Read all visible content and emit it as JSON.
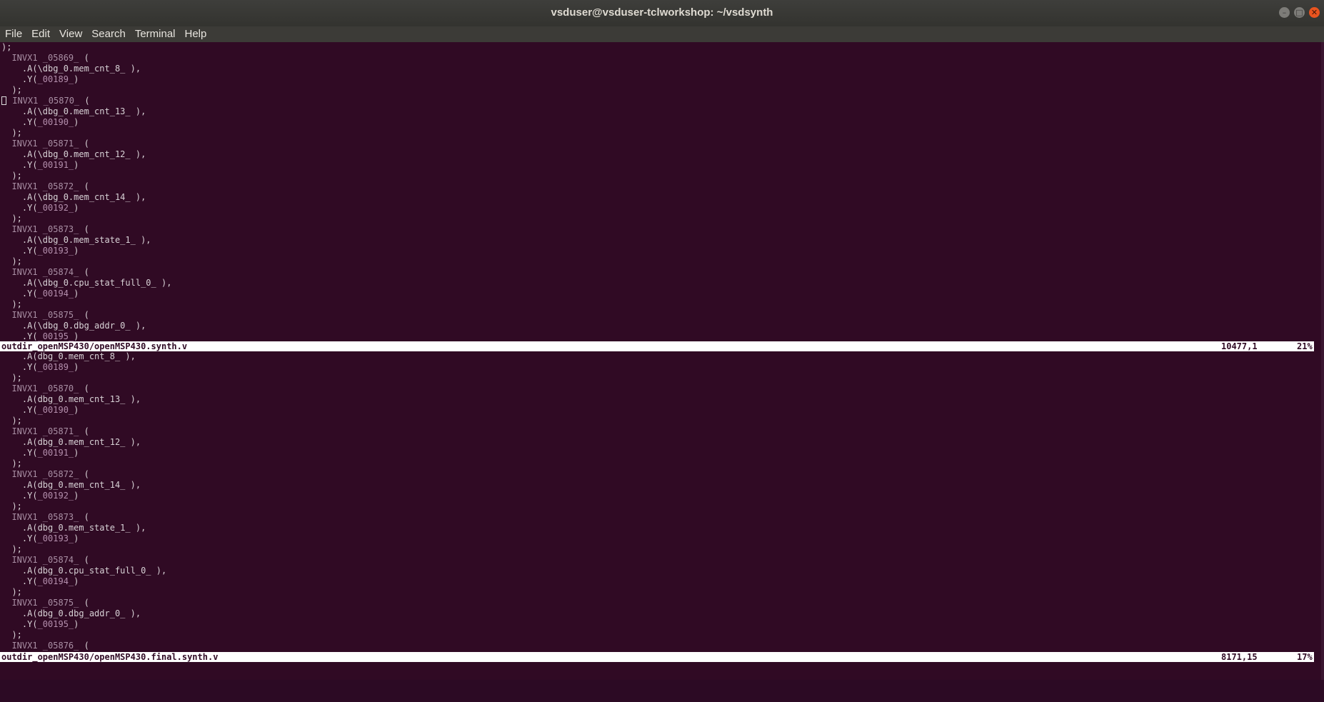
{
  "window": {
    "title": "vsduser@vsduser-tclworkshop: ~/vsdsynth"
  },
  "window_buttons": [
    {
      "name": "minimize",
      "glyph": "–"
    },
    {
      "name": "maximize",
      "glyph": "□"
    },
    {
      "name": "close",
      "glyph": "✕"
    }
  ],
  "menu": [
    "File",
    "Edit",
    "View",
    "Search",
    "Terminal",
    "Help"
  ],
  "top_pane": {
    "status": {
      "file": "outdir_openMSP430/openMSP430.synth.v",
      "position": "10477,1",
      "percent": "21%"
    },
    "lines": [
      ");",
      "  INVX1 _05869_ (",
      "    .A(\\dbg_0.mem_cnt_8_ ),",
      "    .Y(_00189_)",
      "  );",
      "  INVX1 _05870_ (",
      "    .A(\\dbg_0.mem_cnt_13_ ),",
      "    .Y(_00190_)",
      "  );",
      "  INVX1 _05871_ (",
      "    .A(\\dbg_0.mem_cnt_12_ ),",
      "    .Y(_00191_)",
      "  );",
      "  INVX1 _05872_ (",
      "    .A(\\dbg_0.mem_cnt_14_ ),",
      "    .Y(_00192_)",
      "  );",
      "  INVX1 _05873_ (",
      "    .A(\\dbg_0.mem_state_1_ ),",
      "    .Y(_00193_)",
      "  );",
      "  INVX1 _05874_ (",
      "    .A(\\dbg_0.cpu_stat_full_0_ ),",
      "    .Y(_00194_)",
      "  );",
      "  INVX1 _05875_ (",
      "    .A(\\dbg_0.dbg_addr_0_ ),",
      "    .Y(_00195_)"
    ]
  },
  "bottom_pane": {
    "status": {
      "file": "outdir_openMSP430/openMSP430.final.synth.v",
      "position": "8171,15",
      "percent": "17%"
    },
    "lines": [
      "    .A(dbg_0.mem_cnt_8_ ),",
      "    .Y(_00189_)",
      "  );",
      "  INVX1 _05870_ (",
      "    .A(dbg_0.mem_cnt_13_ ),",
      "    .Y(_00190_)",
      "  );",
      "  INVX1 _05871_ (",
      "    .A(dbg_0.mem_cnt_12_ ),",
      "    .Y(_00191_)",
      "  );",
      "  INVX1 _05872_ (",
      "    .A(dbg_0.mem_cnt_14_ ),",
      "    .Y(_00192_)",
      "  );",
      "  INVX1 _05873_ (",
      "    .A(dbg_0.mem_state_1_ ),",
      "    .Y(_00193_)",
      "  );",
      "  INVX1 _05874_ (",
      "    .A(dbg_0.cpu_stat_full_0_ ),",
      "    .Y(_00194_)",
      "  );",
      "  INVX1 _05875_ (",
      "    .A(dbg_0.dbg_addr_0_ ),",
      "    .Y(_00195_)",
      "  );",
      "  INVX1 _05876_ ("
    ]
  }
}
